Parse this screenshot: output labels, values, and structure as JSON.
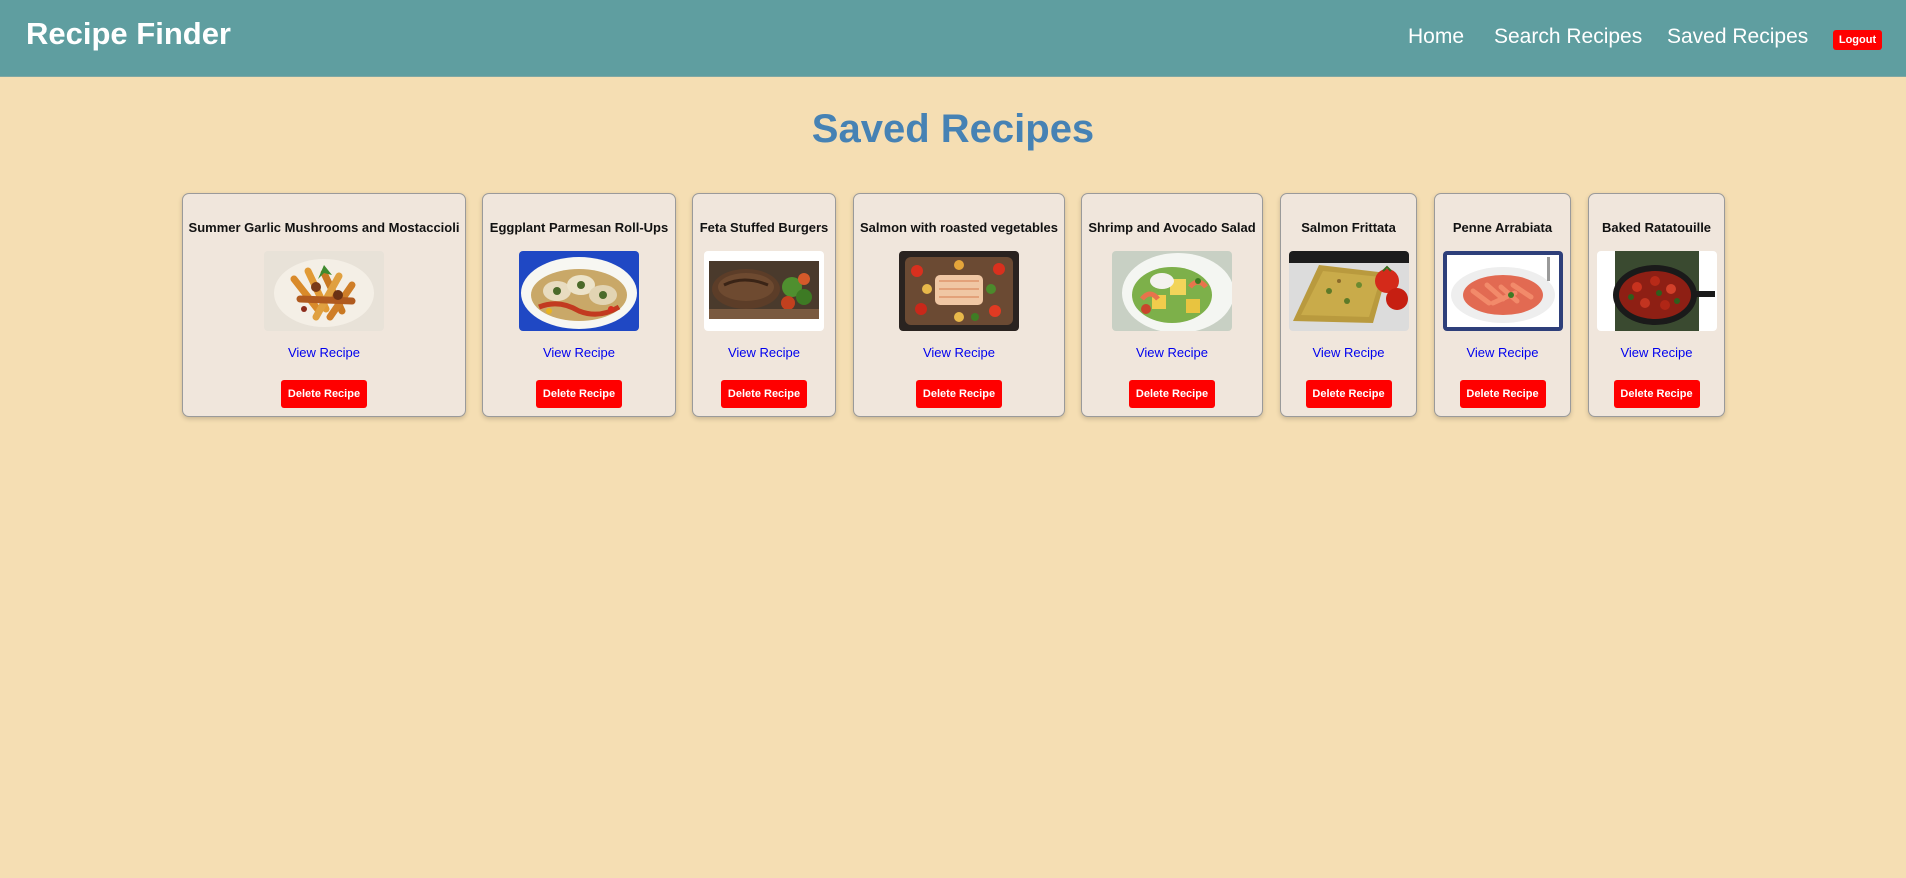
{
  "header": {
    "brand": "Recipe Finder",
    "nav": [
      "Home",
      "Search Recipes",
      "Saved Recipes"
    ],
    "logout_label": "Logout"
  },
  "main": {
    "title": "Saved Recipes",
    "view_label": "View Recipe",
    "delete_label": "Delete Recipe"
  },
  "recipes": [
    {
      "title": "Summer Garlic Mushrooms and Mostaccioli",
      "photo": "penne-pasta-dish"
    },
    {
      "title": "Eggplant Parmesan Roll-Ups",
      "photo": "eggplant-rollups-plate"
    },
    {
      "title": "Feta Stuffed Burgers",
      "photo": "burger-patties"
    },
    {
      "title": "Salmon with roasted vegetables",
      "photo": "salmon-vegetable-tray"
    },
    {
      "title": "Shrimp and Avocado Salad",
      "photo": "shrimp-avocado-bowl"
    },
    {
      "title": "Salmon Frittata",
      "photo": "frittata-with-tomatoes"
    },
    {
      "title": "Penne Arrabiata",
      "photo": "penne-arrabiata-plate"
    },
    {
      "title": "Baked Ratatouille",
      "photo": "ratatouille-skillet"
    }
  ],
  "colors": {
    "header_bg": "#5f9ea0",
    "page_bg": "#f5deb3",
    "title": "#4682b4",
    "card_bg": "#f0e6dc",
    "danger": "#ff0000",
    "link": "#0000ee"
  }
}
